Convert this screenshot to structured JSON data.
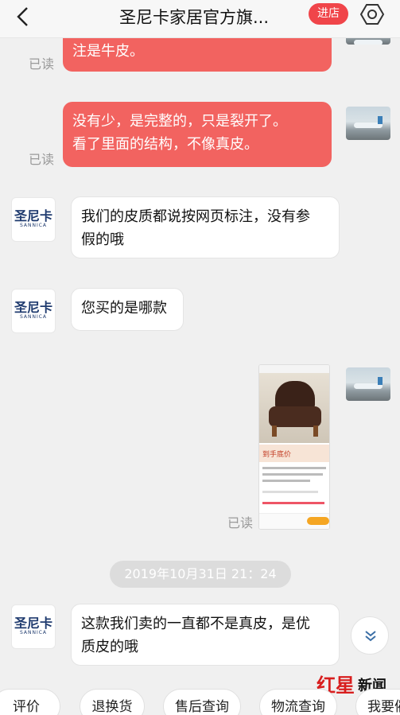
{
  "header": {
    "title": "圣尼卡家居官方旗...",
    "shop_button": "进店"
  },
  "messages": [
    {
      "from": "user",
      "text_line1": "注是牛皮。",
      "status": "已读"
    },
    {
      "from": "user",
      "text_line1": "没有少，是完整的，只是裂开了。",
      "text_line2": "看了里面的结构，不像真皮。",
      "status": "已读"
    },
    {
      "from": "shop",
      "text_line1": "我们的皮质都说按网页标注，没有参",
      "text_line2": "假的哦"
    },
    {
      "from": "shop",
      "text_line1": "您买的是哪款"
    },
    {
      "from": "user",
      "type": "image",
      "status": "已读"
    },
    {
      "from": "shop",
      "text_line1": "这款我们卖的一直都不是真皮，是优",
      "text_line2": "质皮的哦"
    }
  ],
  "shop_avatar": {
    "logo": "圣尼卡",
    "sub": "SANNICA"
  },
  "timestamp": "2019年10月31日  21：24",
  "product_card": {
    "banner": "到手底价"
  },
  "watermark": {
    "red": "红星",
    "black": "新闻"
  },
  "quick_replies": [
    "评价",
    "退换货",
    "售后查询",
    "物流查询",
    "我要催"
  ],
  "colors": {
    "accent": "#f0454a",
    "user_bubble": "#f26360",
    "page_bg": "#f0f0f0"
  }
}
